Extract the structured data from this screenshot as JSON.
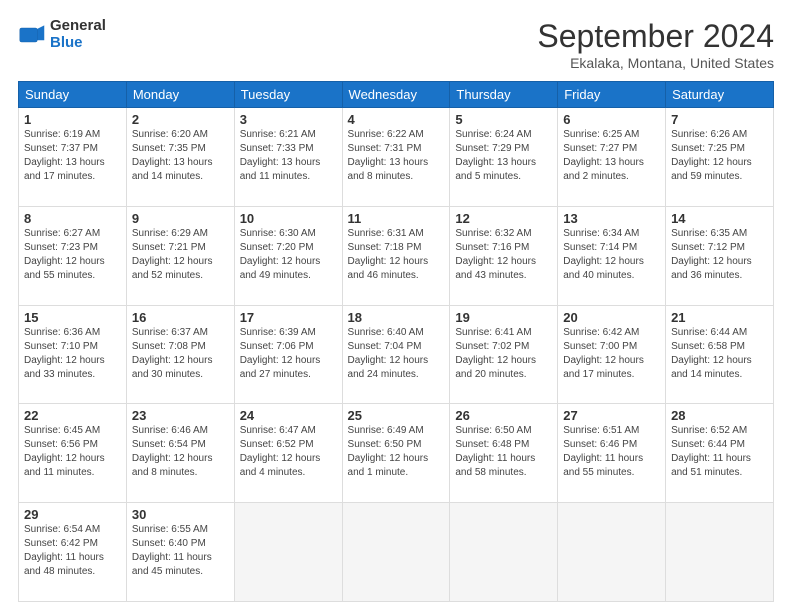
{
  "header": {
    "logo_line1": "General",
    "logo_line2": "Blue",
    "title": "September 2024",
    "subtitle": "Ekalaka, Montana, United States"
  },
  "weekdays": [
    "Sunday",
    "Monday",
    "Tuesday",
    "Wednesday",
    "Thursday",
    "Friday",
    "Saturday"
  ],
  "weeks": [
    [
      {
        "day": "1",
        "info": "Sunrise: 6:19 AM\nSunset: 7:37 PM\nDaylight: 13 hours\nand 17 minutes."
      },
      {
        "day": "2",
        "info": "Sunrise: 6:20 AM\nSunset: 7:35 PM\nDaylight: 13 hours\nand 14 minutes."
      },
      {
        "day": "3",
        "info": "Sunrise: 6:21 AM\nSunset: 7:33 PM\nDaylight: 13 hours\nand 11 minutes."
      },
      {
        "day": "4",
        "info": "Sunrise: 6:22 AM\nSunset: 7:31 PM\nDaylight: 13 hours\nand 8 minutes."
      },
      {
        "day": "5",
        "info": "Sunrise: 6:24 AM\nSunset: 7:29 PM\nDaylight: 13 hours\nand 5 minutes."
      },
      {
        "day": "6",
        "info": "Sunrise: 6:25 AM\nSunset: 7:27 PM\nDaylight: 13 hours\nand 2 minutes."
      },
      {
        "day": "7",
        "info": "Sunrise: 6:26 AM\nSunset: 7:25 PM\nDaylight: 12 hours\nand 59 minutes."
      }
    ],
    [
      {
        "day": "8",
        "info": "Sunrise: 6:27 AM\nSunset: 7:23 PM\nDaylight: 12 hours\nand 55 minutes."
      },
      {
        "day": "9",
        "info": "Sunrise: 6:29 AM\nSunset: 7:21 PM\nDaylight: 12 hours\nand 52 minutes."
      },
      {
        "day": "10",
        "info": "Sunrise: 6:30 AM\nSunset: 7:20 PM\nDaylight: 12 hours\nand 49 minutes."
      },
      {
        "day": "11",
        "info": "Sunrise: 6:31 AM\nSunset: 7:18 PM\nDaylight: 12 hours\nand 46 minutes."
      },
      {
        "day": "12",
        "info": "Sunrise: 6:32 AM\nSunset: 7:16 PM\nDaylight: 12 hours\nand 43 minutes."
      },
      {
        "day": "13",
        "info": "Sunrise: 6:34 AM\nSunset: 7:14 PM\nDaylight: 12 hours\nand 40 minutes."
      },
      {
        "day": "14",
        "info": "Sunrise: 6:35 AM\nSunset: 7:12 PM\nDaylight: 12 hours\nand 36 minutes."
      }
    ],
    [
      {
        "day": "15",
        "info": "Sunrise: 6:36 AM\nSunset: 7:10 PM\nDaylight: 12 hours\nand 33 minutes."
      },
      {
        "day": "16",
        "info": "Sunrise: 6:37 AM\nSunset: 7:08 PM\nDaylight: 12 hours\nand 30 minutes."
      },
      {
        "day": "17",
        "info": "Sunrise: 6:39 AM\nSunset: 7:06 PM\nDaylight: 12 hours\nand 27 minutes."
      },
      {
        "day": "18",
        "info": "Sunrise: 6:40 AM\nSunset: 7:04 PM\nDaylight: 12 hours\nand 24 minutes."
      },
      {
        "day": "19",
        "info": "Sunrise: 6:41 AM\nSunset: 7:02 PM\nDaylight: 12 hours\nand 20 minutes."
      },
      {
        "day": "20",
        "info": "Sunrise: 6:42 AM\nSunset: 7:00 PM\nDaylight: 12 hours\nand 17 minutes."
      },
      {
        "day": "21",
        "info": "Sunrise: 6:44 AM\nSunset: 6:58 PM\nDaylight: 12 hours\nand 14 minutes."
      }
    ],
    [
      {
        "day": "22",
        "info": "Sunrise: 6:45 AM\nSunset: 6:56 PM\nDaylight: 12 hours\nand 11 minutes."
      },
      {
        "day": "23",
        "info": "Sunrise: 6:46 AM\nSunset: 6:54 PM\nDaylight: 12 hours\nand 8 minutes."
      },
      {
        "day": "24",
        "info": "Sunrise: 6:47 AM\nSunset: 6:52 PM\nDaylight: 12 hours\nand 4 minutes."
      },
      {
        "day": "25",
        "info": "Sunrise: 6:49 AM\nSunset: 6:50 PM\nDaylight: 12 hours\nand 1 minute."
      },
      {
        "day": "26",
        "info": "Sunrise: 6:50 AM\nSunset: 6:48 PM\nDaylight: 11 hours\nand 58 minutes."
      },
      {
        "day": "27",
        "info": "Sunrise: 6:51 AM\nSunset: 6:46 PM\nDaylight: 11 hours\nand 55 minutes."
      },
      {
        "day": "28",
        "info": "Sunrise: 6:52 AM\nSunset: 6:44 PM\nDaylight: 11 hours\nand 51 minutes."
      }
    ],
    [
      {
        "day": "29",
        "info": "Sunrise: 6:54 AM\nSunset: 6:42 PM\nDaylight: 11 hours\nand 48 minutes."
      },
      {
        "day": "30",
        "info": "Sunrise: 6:55 AM\nSunset: 6:40 PM\nDaylight: 11 hours\nand 45 minutes."
      },
      {
        "day": "",
        "info": ""
      },
      {
        "day": "",
        "info": ""
      },
      {
        "day": "",
        "info": ""
      },
      {
        "day": "",
        "info": ""
      },
      {
        "day": "",
        "info": ""
      }
    ]
  ]
}
